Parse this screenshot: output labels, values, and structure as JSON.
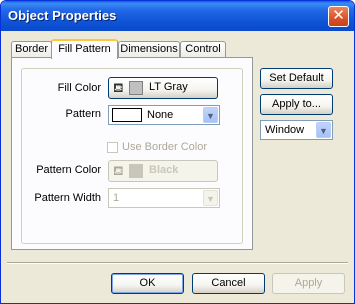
{
  "window": {
    "title": "Object Properties"
  },
  "tabs": [
    {
      "label": "Border"
    },
    {
      "label": "Fill Pattern"
    },
    {
      "label": "Dimensions"
    },
    {
      "label": "Control"
    }
  ],
  "form": {
    "fill_color_label": "Fill Color",
    "fill_color_value": "LT Gray",
    "pattern_label": "Pattern",
    "pattern_value": "None",
    "use_border_color_label": "Use Border Color",
    "pattern_color_label": "Pattern Color",
    "pattern_color_value": "Black",
    "pattern_width_label": "Pattern Width",
    "pattern_width_value": "1"
  },
  "side": {
    "set_default_label": "Set Default",
    "apply_to_label": "Apply to...",
    "apply_scope_value": "Window"
  },
  "footer": {
    "ok_label": "OK",
    "cancel_label": "Cancel",
    "apply_label": "Apply"
  },
  "colors": {
    "fill_swatch": "#c0c0c0",
    "pattern_swatch": "#ffffff",
    "pattern_color_swatch": "#c8c6bb",
    "title_bar": "#0b4acb",
    "active_tab_highlight": "#ffc83c"
  },
  "icons": {
    "fill_color_icon": "paint-bucket-icon",
    "pattern_color_icon": "paint-bucket-icon"
  }
}
